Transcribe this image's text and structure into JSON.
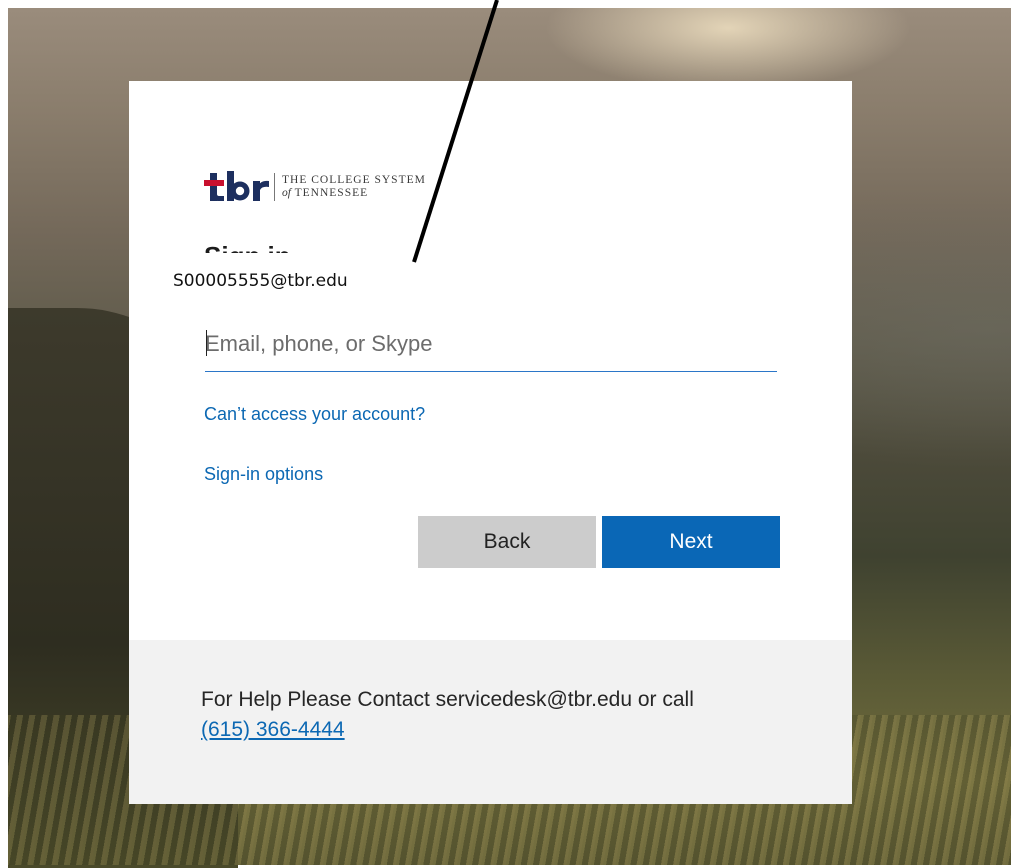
{
  "background": {
    "description_colors": {
      "sky": "#9a8c7c",
      "ground": "#4c4a3a"
    }
  },
  "logo": {
    "mark": "tbr",
    "line1": "THE COLLEGE SYSTEM",
    "line2_prefix": "of",
    "line2": "TENNESSEE",
    "mark_colors": {
      "primary": "#1d2f5f",
      "accent": "#c8102e"
    }
  },
  "page_title": "Sign in",
  "annotation": {
    "label": "S00005555@tbr.edu",
    "pointer": "arrow-line"
  },
  "email": {
    "value": "",
    "placeholder": "Email, phone, or Skype"
  },
  "links": {
    "cant_access": "Can’t access your account?",
    "signin_options": "Sign-in options"
  },
  "buttons": {
    "back": "Back",
    "next": "Next"
  },
  "footer": {
    "help_text": "For Help Please Contact servicedesk@tbr.edu or call",
    "phone": "(615) 366-4444"
  },
  "colors": {
    "accent": "#0a67b6",
    "link": "#0c68b3",
    "back_button": "#cccccc",
    "footer_bg": "#f2f2f2"
  }
}
